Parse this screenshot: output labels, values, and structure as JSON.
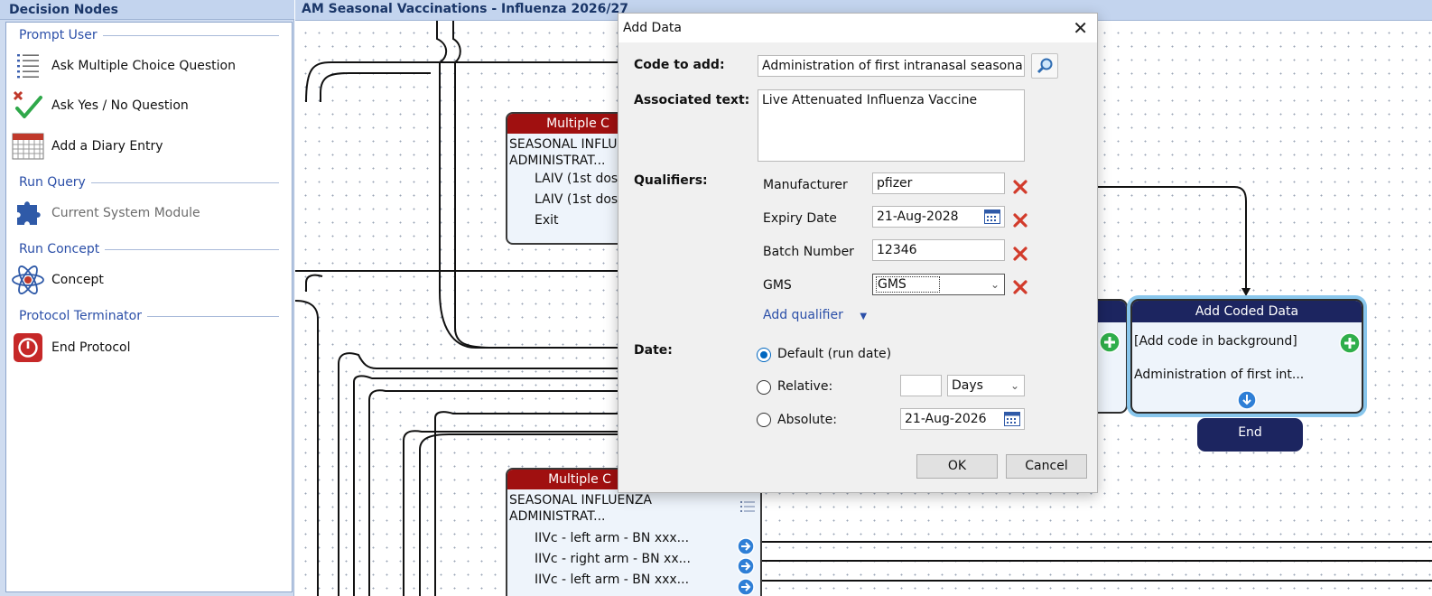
{
  "left_panel": {
    "title": "Decision Nodes",
    "groups": [
      {
        "heading": "Prompt User",
        "items": [
          {
            "label": "Ask Multiple Choice Question",
            "icon": "list-icon"
          },
          {
            "label": "Ask Yes / No Question",
            "icon": "yes-no-icon"
          },
          {
            "label": "Add a Diary Entry",
            "icon": "calendar-icon"
          }
        ]
      },
      {
        "heading": "Run Query",
        "items": [
          {
            "label": "Current System Module",
            "icon": "puzzle-icon",
            "disabled": true
          }
        ]
      },
      {
        "heading": "Run Concept",
        "items": [
          {
            "label": "Concept",
            "icon": "atom-icon"
          }
        ]
      },
      {
        "heading": "Protocol Terminator",
        "items": [
          {
            "label": "End Protocol",
            "icon": "power-icon"
          }
        ]
      }
    ]
  },
  "canvas": {
    "title": "AM Seasonal Vaccinations - Influenza 2026/27",
    "mc_node_1": {
      "header": "Multiple C",
      "text_line1": "SEASONAL INFLUE",
      "text_line2": "ADMINISTRAT...",
      "options": [
        "LAIV (1st dos",
        "LAIV (1st dos",
        "Exit"
      ]
    },
    "mc_node_2": {
      "header": "Multiple C",
      "text_line1": "SEASONAL INFLUENZA",
      "text_line2": "ADMINISTRAT...",
      "options": [
        "IIVc - left arm - BN xxx...",
        "IIVc - right arm - BN xx...",
        "IIVc - left arm - BN xxx..."
      ]
    },
    "coded_node": {
      "header": "Add Coded Data",
      "line1": "[Add code in background]",
      "line2": "Administration of first int..."
    },
    "end_node": {
      "label": "End"
    }
  },
  "dialog": {
    "title": "Add Data",
    "code_label": "Code to add:",
    "code_value": "Administration of first intranasal seasonal inf",
    "assoc_label": "Associated text:",
    "assoc_value": "Live Attenuated Influenza Vaccine",
    "qualifiers_label": "Qualifiers:",
    "qualifiers": [
      {
        "name": "Manufacturer",
        "value": "pfizer"
      },
      {
        "name": "Expiry Date",
        "value": "21-Aug-2028"
      },
      {
        "name": "Batch Number",
        "value": "12346"
      },
      {
        "name": "GMS",
        "value": "GMS"
      }
    ],
    "add_qualifier": "Add qualifier",
    "date_label": "Date:",
    "date_options": {
      "default": "Default (run date)",
      "relative": "Relative:",
      "absolute": "Absolute:"
    },
    "relative_value": "",
    "relative_unit": "Days",
    "absolute_value": "21-Aug-2026",
    "ok": "OK",
    "cancel": "Cancel"
  },
  "colors": {
    "panel_header": "#c3d4ee",
    "mc_header": "#a01010",
    "coded_header": "#1c2560",
    "selection_glow": "#88c6ec"
  }
}
